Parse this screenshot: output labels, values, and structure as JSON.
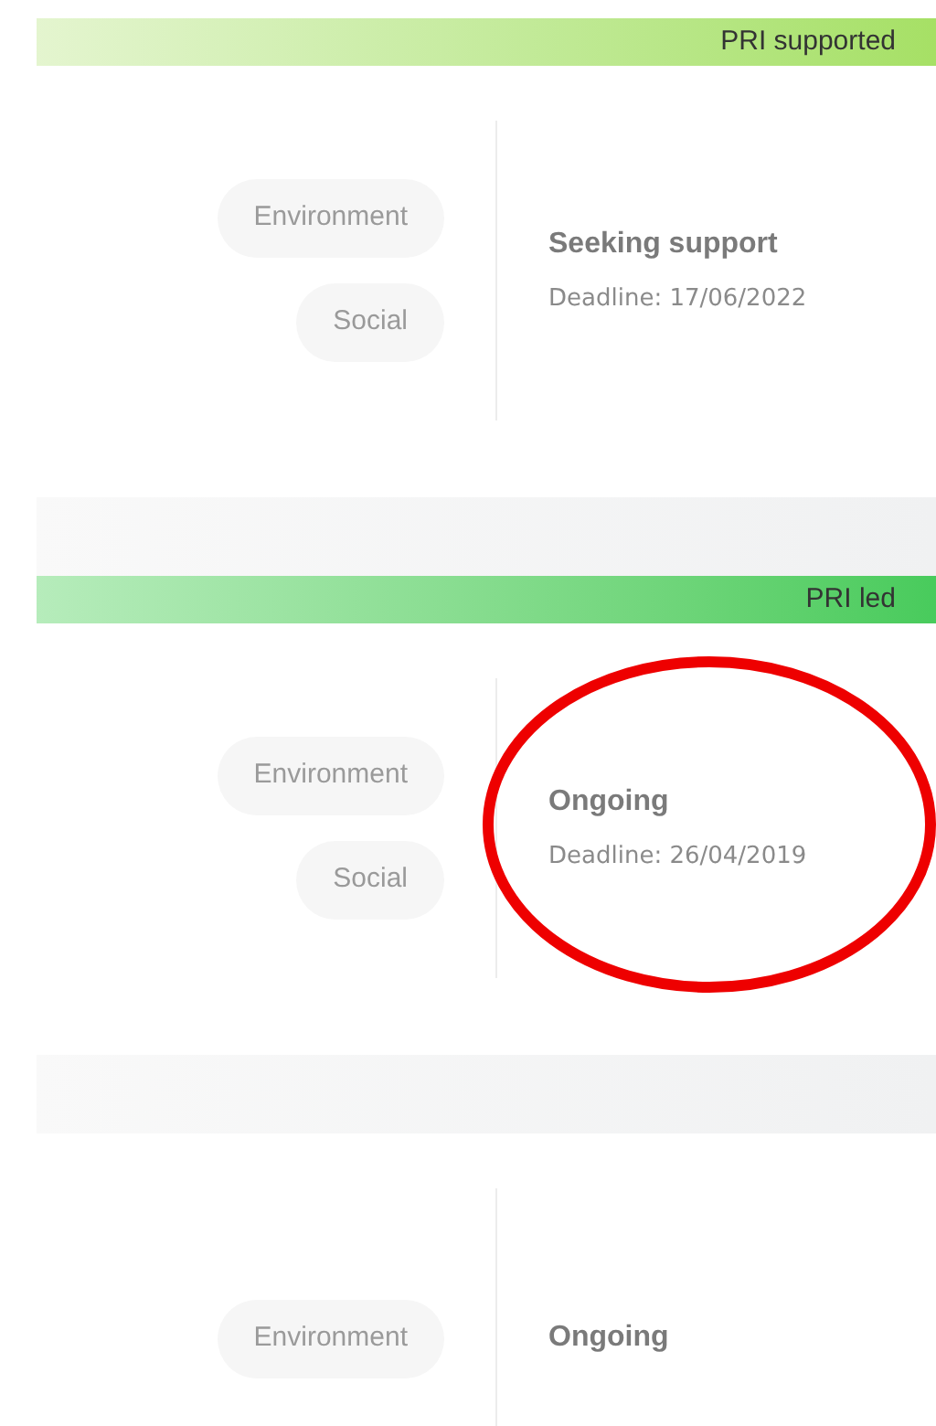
{
  "cards": [
    {
      "banner": {
        "kind": "supported",
        "label": "PRI supported"
      },
      "tags": [
        "Environment",
        "Social"
      ],
      "status": "Seeking support",
      "deadline": "Deadline: 17/06/2022",
      "footer": true
    },
    {
      "banner": {
        "kind": "led",
        "label": "PRI led"
      },
      "tags": [
        "Environment",
        "Social"
      ],
      "status": "Ongoing",
      "deadline": "Deadline: 26/04/2019",
      "footer": true,
      "annotation": {
        "kind": "ellipse"
      }
    },
    {
      "tags": [
        "Environment"
      ],
      "status": "Ongoing"
    }
  ]
}
